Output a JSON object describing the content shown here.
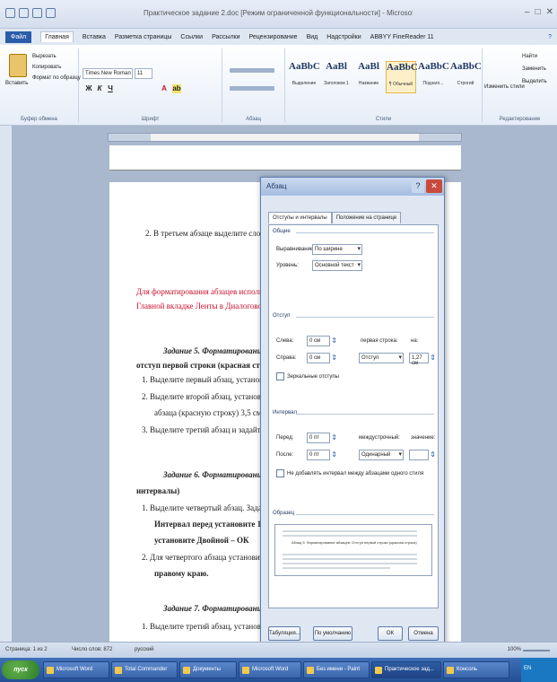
{
  "window": {
    "title": "Практическое задание 2.doc [Режим ограниченной функциональности] - Microsoft Word",
    "controls": [
      "–",
      "□",
      "✕"
    ]
  },
  "ribbon_tabs": [
    {
      "label": "Файл"
    },
    {
      "label": "Главная"
    },
    {
      "label": "Вставка"
    },
    {
      "label": "Разметка страницы"
    },
    {
      "label": "Ссылки"
    },
    {
      "label": "Рассылки"
    },
    {
      "label": "Рецензирование"
    },
    {
      "label": "Вид"
    },
    {
      "label": "Надстройки"
    },
    {
      "label": "ABBYY FineReader 11"
    }
  ],
  "ribbon": {
    "clipboard": {
      "paste": "Вставить",
      "cut": "Вырезать",
      "copy": "Копировать",
      "format": "Формат по образцу",
      "group": "Буфер обмена"
    },
    "font": {
      "name": "Times New Roman",
      "size": "11",
      "group": "Шрифт"
    },
    "paragraph": {
      "group": "Абзац"
    },
    "styles": {
      "group": "Стили",
      "items": [
        {
          "sample": "AaBbC",
          "name": "Выделение"
        },
        {
          "sample": "AaBl",
          "name": "Заголовок 1"
        },
        {
          "sample": "AaBl",
          "name": "Название"
        },
        {
          "sample": "AaBbC",
          "name": "¶ Обычный"
        },
        {
          "sample": "AaBbC",
          "name": "Подзаго..."
        },
        {
          "sample": "AaBbC",
          "name": "Строгий"
        }
      ],
      "change": "Изменить стили"
    },
    "editing": {
      "find": "Найти",
      "replace": "Заменить",
      "select": "Выделить",
      "group": "Редактирование"
    }
  },
  "document": {
    "lines": [
      {
        "text": "2. В третьем абзаце выделите слова и",
        "style": ""
      },
      {
        "text": "Для форматирования абзацев используют",
        "style": "red"
      },
      {
        "text": "Главной вкладке Ленты в Диалоговом о",
        "style": "red"
      },
      {
        "text": "Задание 5. Форматирование",
        "style": "bold ital"
      },
      {
        "text": "отступ первой строки (красная строка)",
        "style": "bold"
      },
      {
        "text": "1. Выделите первый абзац, установит",
        "style": ""
      },
      {
        "text": "2. Выделите второй абзац, установит",
        "style": ""
      },
      {
        "text": "абзаца (красную строку) 3,5 см.",
        "style": ""
      },
      {
        "text": "3. Выделите третий абзац и задайте от",
        "style": ""
      },
      {
        "text": "Задание 6. Форматирование",
        "style": "bold ital"
      },
      {
        "text": "интервалы)",
        "style": "bold"
      },
      {
        "text": "1. Выделите четвертый абзац. Зада",
        "style": ""
      },
      {
        "text": "Интервал перед установите 18",
        "style": "bold"
      },
      {
        "text": "установите Двойной – ОК",
        "style": "bold"
      },
      {
        "text": "2. Для четвертого абзаца установит",
        "style": ""
      },
      {
        "text": "правому краю.",
        "style": "bold"
      },
      {
        "text": "Задание 7. Форматирование абз",
        "style": "bold ital"
      },
      {
        "text": "1. Выделите третий абзац, установит",
        "style": ""
      }
    ]
  },
  "dialog": {
    "title": "Абзац",
    "tabs": [
      "Отступы и интервалы",
      "Положение на странице"
    ],
    "general": {
      "section": "Общие",
      "align_label": "Выравнивание:",
      "align_value": "По ширине",
      "level_label": "Уровень:",
      "level_value": "Основной текст"
    },
    "indent": {
      "section": "Отступ",
      "left_label": "Слева:",
      "left_value": "0 см",
      "right_label": "Справа:",
      "right_value": "0 см",
      "first_label": "первая строка:",
      "first_value": "Отступ",
      "on_label": "на:",
      "on_value": "1,27 см",
      "mirror": "Зеркальные отступы"
    },
    "spacing": {
      "section": "Интервал",
      "before_label": "Перед:",
      "before_value": "0 пт",
      "after_label": "После:",
      "after_value": "0 пт",
      "line_label": "междустрочный:",
      "line_value": "Одинарный",
      "at_label": "значение:",
      "at_value": "",
      "no_add": "Не добавлять интервал между абзацами одного стиля"
    },
    "preview": {
      "section": "Образец",
      "sample": "Абзац 5. Форматирование абзацев. Отступ первой строки (красная строка)"
    },
    "buttons": {
      "tabs": "Табуляция...",
      "default": "По умолчанию",
      "ok": "ОК",
      "cancel": "Отмена"
    }
  },
  "statusbar": {
    "page": "Страница: 1 из 2",
    "words": "Число слов: 872",
    "lang": "русский",
    "zoom": "100%"
  },
  "taskbar": {
    "start": "пуск",
    "items": [
      {
        "label": "Microsoft Word"
      },
      {
        "label": "Total Commander"
      },
      {
        "label": "Документы"
      },
      {
        "label": "Microsoft Word"
      },
      {
        "label": "Без имени - Paint"
      },
      {
        "label": "Практическое зад..."
      },
      {
        "label": "Консоль"
      }
    ],
    "tray": "EN"
  }
}
